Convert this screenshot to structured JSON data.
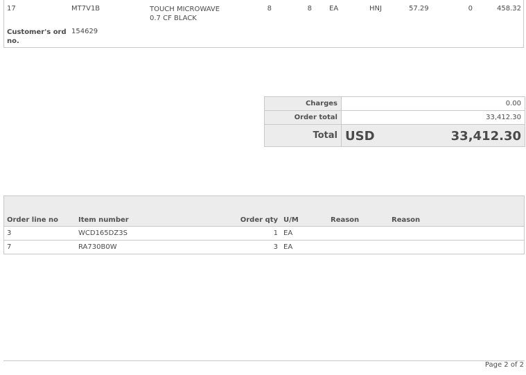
{
  "order_line": {
    "line_no": "17",
    "item_number": "MT7V1B",
    "description": "TOUCH MICROWAVE 0.7 CF BLACK",
    "ordered_qty": "8",
    "qty": "8",
    "um": "EA",
    "warehouse": "HNJ",
    "price": "57.29",
    "discount": "0",
    "amount": "458.32",
    "customer_ord_label": "Customer's ord no.",
    "customer_ord_value": "154629"
  },
  "totals": {
    "charges_label": "Charges",
    "charges_value": "0.00",
    "order_total_label": "Order total",
    "order_total_value": "33,412.30",
    "total_label": "Total",
    "currency": "USD",
    "total_value": "33,412.30"
  },
  "lines_table": {
    "headers": [
      "Order line no",
      "Item number",
      "Order qty",
      "U/M",
      "Reason",
      "Reason"
    ],
    "rows": [
      {
        "line_no": "3",
        "item_number": "WCD165DZ3S",
        "qty": "1",
        "um": "EA",
        "reason1": "",
        "reason2": ""
      },
      {
        "line_no": "7",
        "item_number": "RA730B0W",
        "qty": "3",
        "um": "EA",
        "reason1": "",
        "reason2": ""
      }
    ]
  },
  "footer": {
    "page": "Page 2 of 2"
  }
}
